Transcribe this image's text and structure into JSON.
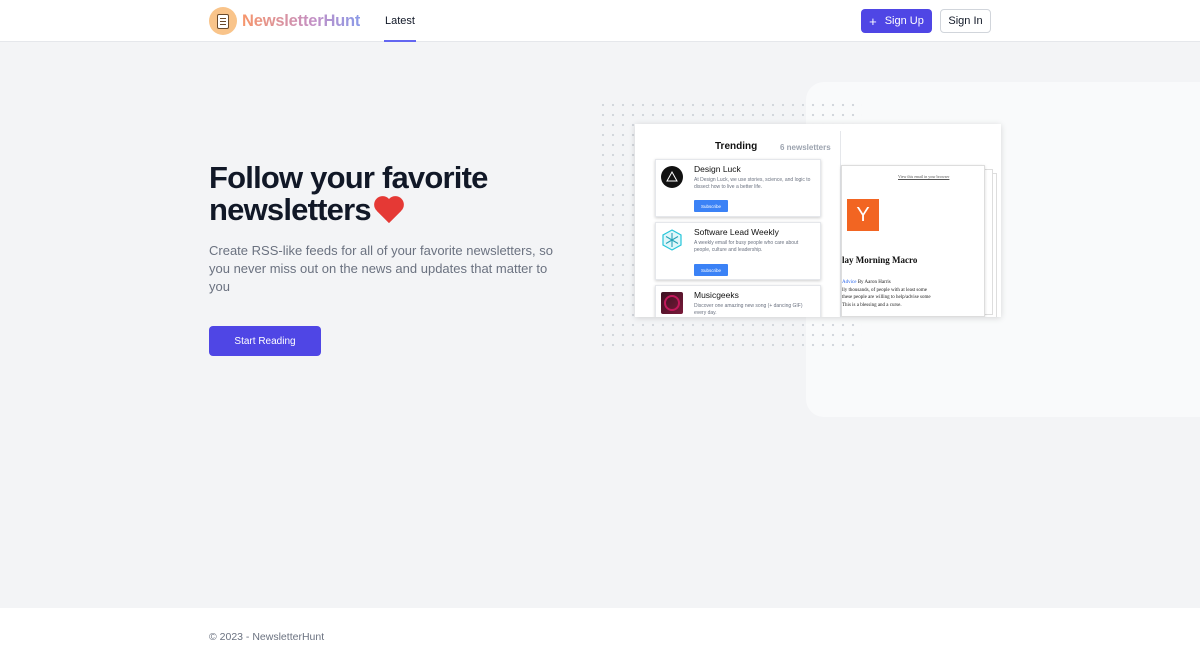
{
  "nav": {
    "brand": "NewsletterHunt",
    "links": [
      {
        "label": "Latest"
      }
    ],
    "signup_label": "Sign Up",
    "signin_label": "Sign In"
  },
  "hero": {
    "title_line1": "Follow your favorite",
    "title_line2": "newsletters",
    "subtitle": "Create RSS-like feeds for all of your favorite newsletters, so you never miss out on the news and updates that matter to you",
    "cta_label": "Start Reading"
  },
  "preview": {
    "trending_title": "Trending",
    "trending_count": "6 newsletters",
    "cards": [
      {
        "name": "Design Luck",
        "description": "At Design Luck, we use stories, science, and logic to dissect how to live a better life.",
        "button": "Subscribe",
        "icon": "design-luck-icon"
      },
      {
        "name": "Software Lead Weekly",
        "description": "A weekly email for busy people who care about people, culture and leadership.",
        "button": "Subscribe",
        "icon": "snowflake-icon"
      },
      {
        "name": "Musicgeeks",
        "description": "Discover one amazing new song (+ dancing GIF) every day.",
        "button": "",
        "icon": "music-icon"
      }
    ],
    "email": {
      "browser_link": "View this email in your browser",
      "logo_letter": "Y",
      "title": "lay Morning Macro",
      "body_link": "Advice",
      "body_author": " By Aaron Harris",
      "body_lines": [
        "lly thousands, of people with at least some",
        "these people are willing to help/advise some",
        "This is a blessing and a curse."
      ]
    }
  },
  "footer": {
    "copyright": "© 2023 - NewsletterHunt"
  },
  "colors": {
    "primary": "#4f46e5",
    "heart": "#e53935",
    "nav_underline": "#6366f1"
  }
}
